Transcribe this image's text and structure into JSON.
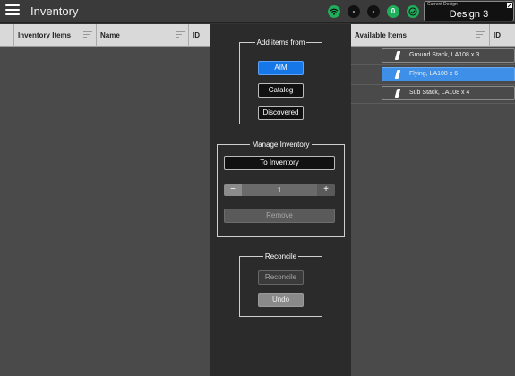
{
  "app": {
    "title": "Inventory"
  },
  "status": {
    "icons": [
      "wifi-icon",
      "status-dot-1",
      "status-dot-2",
      "count-badge",
      "check-icon"
    ],
    "count": "0",
    "dot1": "-",
    "dot2": "-"
  },
  "design": {
    "label": "Current Design",
    "value": "Design 3"
  },
  "inventory_table": {
    "columns": [
      "Inventory Items",
      "Name",
      "ID"
    ]
  },
  "add_items": {
    "title": "Add items from",
    "options": [
      "AIM",
      "Catalog",
      "Discovered"
    ],
    "selected": "AIM"
  },
  "manage": {
    "title": "Manage Inventory",
    "to_inventory_label": "To Inventory",
    "quantity": "1",
    "minus": "−",
    "plus": "+",
    "remove_label": "Remove"
  },
  "reconcile": {
    "title": "Reconcile",
    "reconcile_label": "Reconcile",
    "undo_label": "Undo"
  },
  "available": {
    "columns": [
      "Available Items",
      "ID"
    ],
    "items": [
      {
        "label": "Ground Stack, LA108 x 3",
        "selected": false
      },
      {
        "label": "Flying, LA108 x 6",
        "selected": true
      },
      {
        "label": "Sub Stack, LA108 x 4",
        "selected": false
      }
    ]
  },
  "colors": {
    "accent": "#1677e8",
    "selected_row": "#3d8fe8",
    "status_green": "#1fae5a"
  }
}
